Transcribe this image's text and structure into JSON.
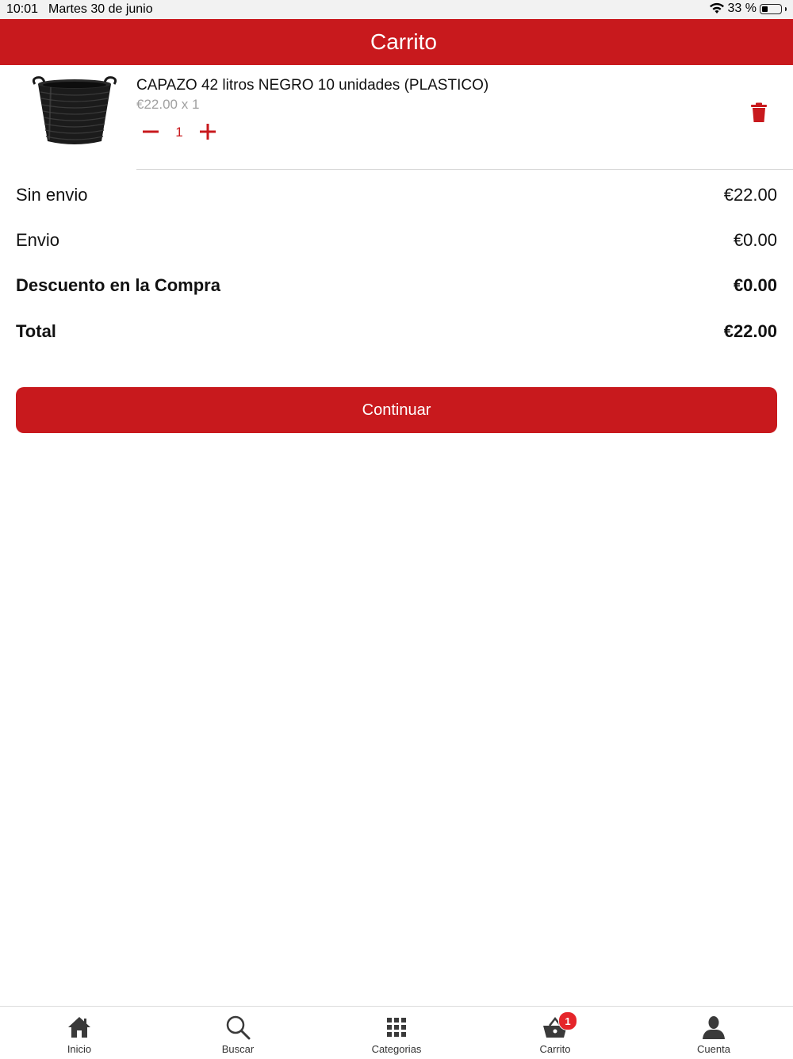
{
  "status_bar": {
    "time": "10:01",
    "date": "Martes 30 de junio",
    "battery": "33 %",
    "wifi_icon": "wifi-icon",
    "battery_icon": "battery-icon",
    "battery_level": 0.33
  },
  "header": {
    "title": "Carrito"
  },
  "cart": {
    "items": [
      {
        "name": "CAPAZO 42 litros NEGRO 10 unidades (PLASTICO)",
        "price_line": "€22.00 x 1",
        "quantity": "1",
        "image_icon": "black-bucket-image",
        "minus_icon": "minus-icon",
        "plus_icon": "plus-icon",
        "delete_icon": "trash-icon"
      }
    ]
  },
  "summary": {
    "subtotal": {
      "label": "Sin envio",
      "value": "€22.00"
    },
    "shipping": {
      "label": "Envio",
      "value": "€0.00"
    },
    "discount": {
      "label": "Descuento en la Compra",
      "value": "€0.00"
    },
    "total": {
      "label": "Total",
      "value": "€22.00"
    }
  },
  "continue_button": {
    "label": "Continuar"
  },
  "tab_bar": {
    "tabs": [
      {
        "label": "Inicio",
        "icon": "home-icon"
      },
      {
        "label": "Buscar",
        "icon": "search-icon"
      },
      {
        "label": "Categorias",
        "icon": "grid-icon"
      },
      {
        "label": "Carrito",
        "icon": "basket-icon",
        "badge": "1"
      },
      {
        "label": "Cuenta",
        "icon": "user-icon"
      }
    ]
  },
  "colors": {
    "brand_red": "#c8191d",
    "badge_red": "#e5252a",
    "muted_text": "#a0a0a0"
  }
}
